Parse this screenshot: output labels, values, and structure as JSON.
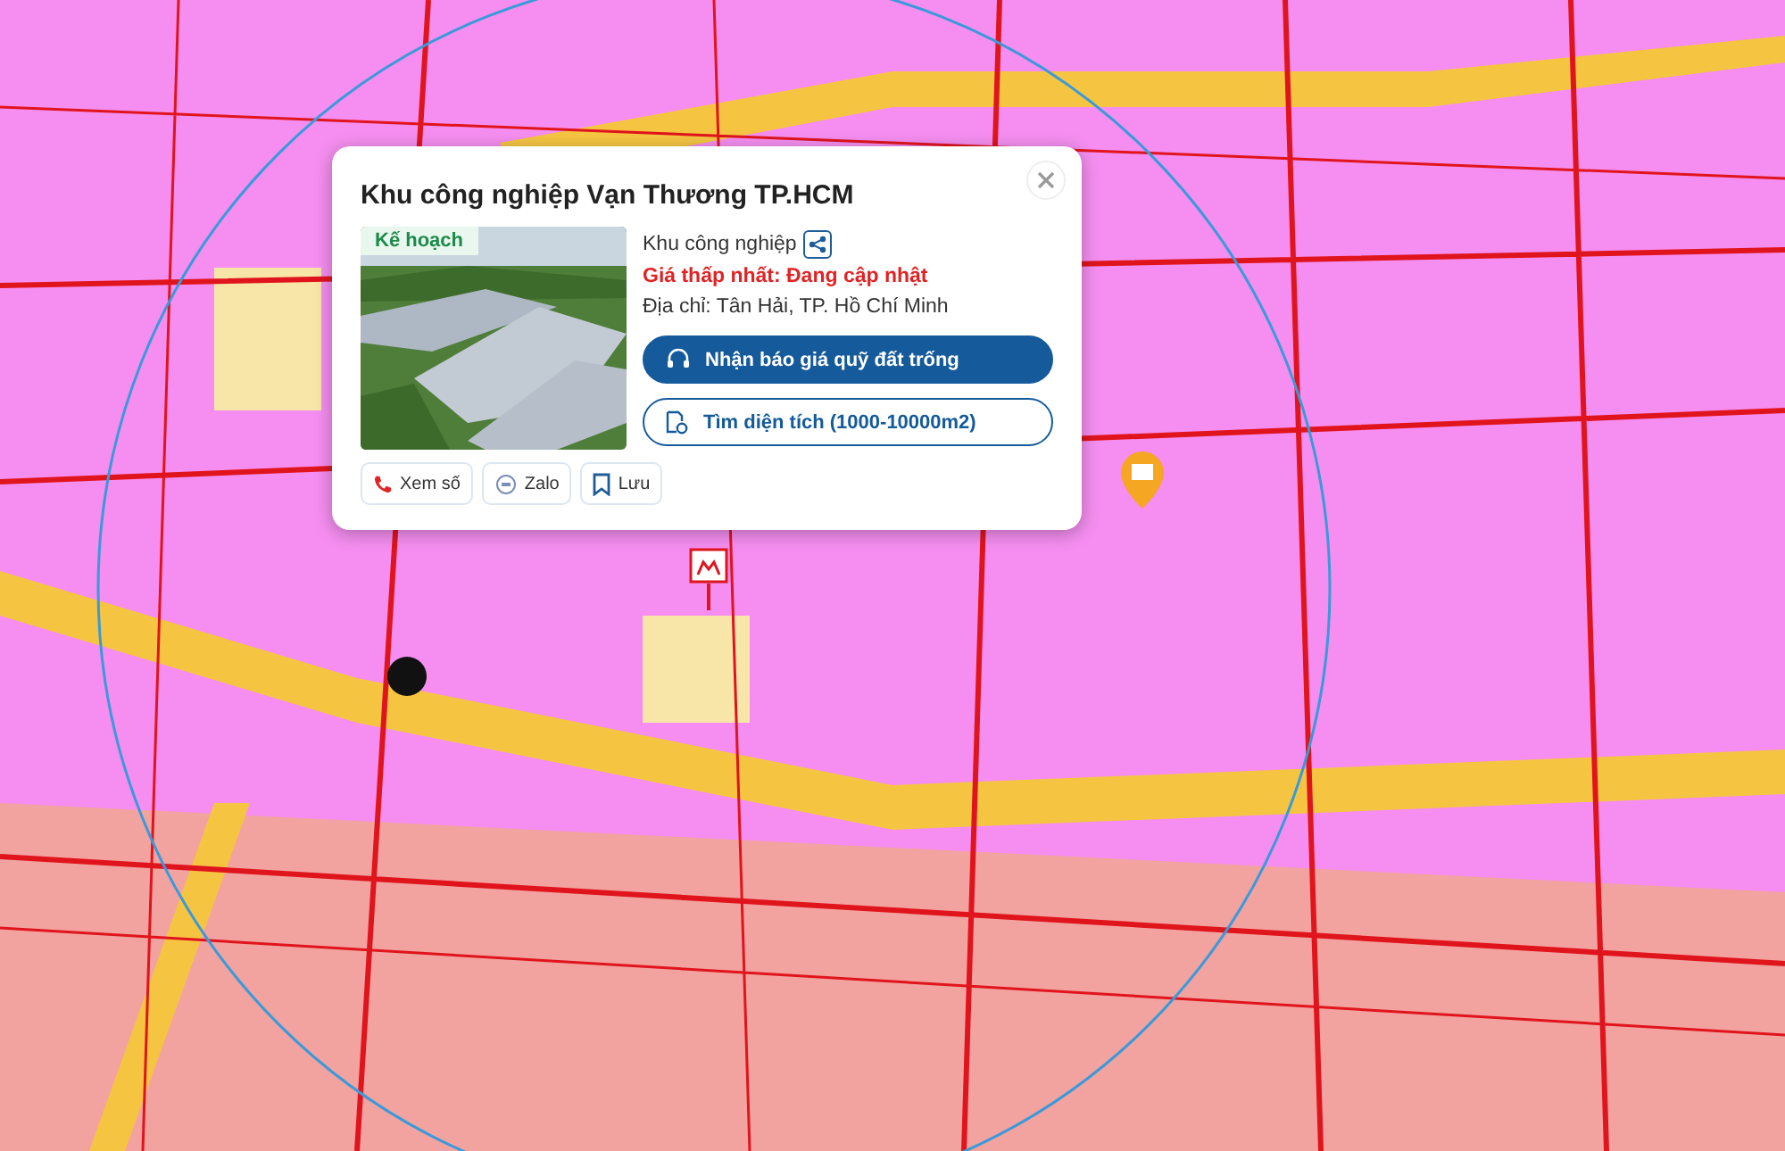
{
  "popup": {
    "title": "Khu công nghiệp Vạn Thương TP.HCM",
    "photo": {
      "badge": "Kế hoạch"
    },
    "category": "Khu công nghiệp",
    "price": "Giá thấp nhất: Đang cập nhật",
    "address": "Địa chỉ: Tân Hải, TP. Hồ Chí Minh",
    "buttons": [
      {
        "kind": "primary",
        "label": "Nhận báo giá quỹ đất trống"
      },
      {
        "kind": "outline",
        "label": "Tìm diện tích (1000-10000m2)"
      }
    ],
    "actions": [
      {
        "kind": "phone",
        "label": "Xem số"
      },
      {
        "kind": "zalo",
        "label": "Zalo"
      },
      {
        "kind": "save",
        "label": "Lưu"
      }
    ]
  }
}
